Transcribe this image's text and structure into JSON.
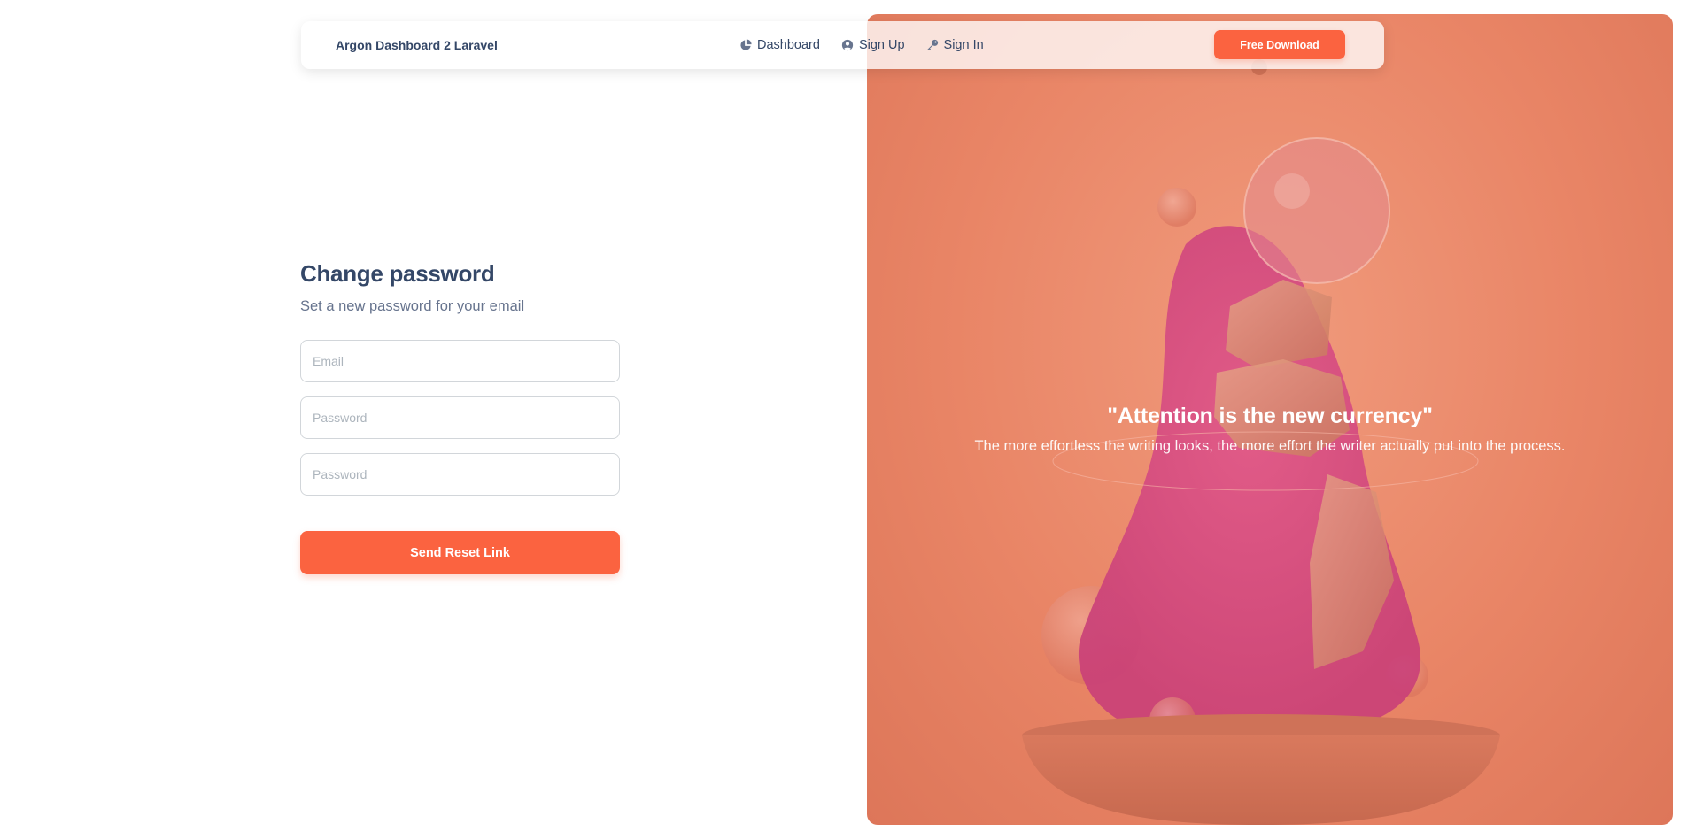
{
  "navbar": {
    "brand": "Argon Dashboard 2 Laravel",
    "links": [
      {
        "label": "Dashboard",
        "icon": "pie-chart-icon"
      },
      {
        "label": "Sign Up",
        "icon": "user-circle-icon"
      },
      {
        "label": "Sign In",
        "icon": "key-icon"
      }
    ],
    "cta_label": "Free Download"
  },
  "form": {
    "title": "Change password",
    "subtitle": "Set a new password for your email",
    "email_placeholder": "Email",
    "password_placeholder": "Password",
    "password_confirm_placeholder": "Password",
    "submit_label": "Send Reset Link"
  },
  "hero": {
    "quote_title": "\"Attention is the new currency\"",
    "quote_body": "The more effortless the writing looks, the more effort the writer actually put into the process."
  },
  "colors": {
    "accent": "#fb6340",
    "text_dark": "#344767",
    "text_muted": "#67748e",
    "panel_overlay": "#e98566"
  }
}
